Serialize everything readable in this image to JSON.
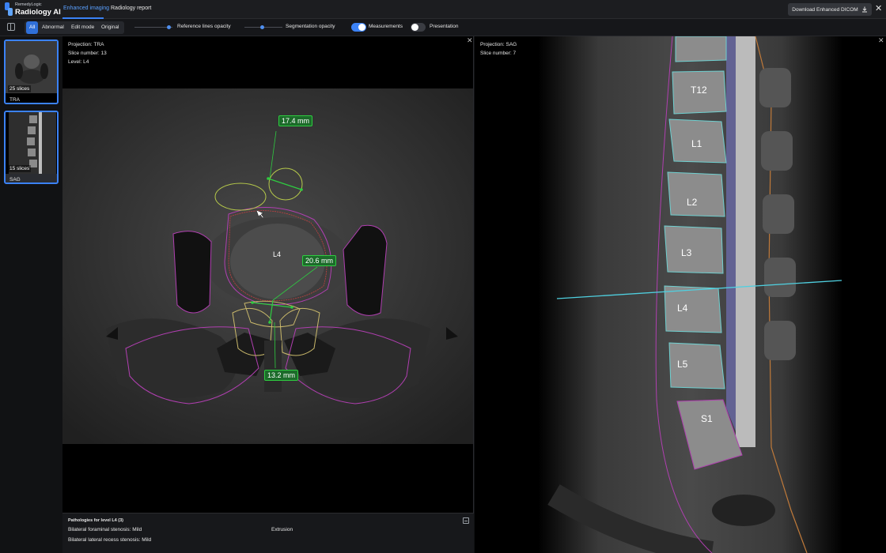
{
  "header": {
    "brand_small": "RemedyLogic",
    "brand": "Radiology AI",
    "tabs": [
      {
        "label": "Enhanced imaging",
        "active": true
      },
      {
        "label": "Radiology report",
        "active": false
      }
    ],
    "download_label": "Download Enhanced DICOM",
    "close_icon": "close-icon"
  },
  "toolbar": {
    "filters": [
      {
        "label": "All",
        "active": true
      },
      {
        "label": "Abnormal",
        "active": false
      },
      {
        "label": "Edit mode",
        "active": false
      },
      {
        "label": "Original",
        "active": false
      }
    ],
    "reference_lines_label": "Reference lines opacity",
    "reference_lines_value": 0.9,
    "segmentation_label": "Segmentation opacity",
    "segmentation_value": 0.45,
    "measurements_label": "Measurements",
    "measurements_on": true,
    "presentation_label": "Presentation",
    "presentation_on": false,
    "accent": "#3b82f6"
  },
  "series": [
    {
      "count": "25 slices",
      "name": "TRA"
    },
    {
      "count": "15 slices",
      "name": "SAG"
    }
  ],
  "viewer_left": {
    "projection": "Projection: TRA",
    "slice": "Slice number: 13",
    "level": "Level: L4",
    "vertebra_label": "L4",
    "measurements": [
      "17.4 mm",
      "20.6 mm",
      "13.2 mm"
    ],
    "measurement_color": "#2ecc40"
  },
  "viewer_right": {
    "projection": "Projection: SAG",
    "slice": "Slice number: 7",
    "vertebrae": [
      "T12",
      "L1",
      "L2",
      "L3",
      "L4",
      "L5",
      "S1"
    ]
  },
  "pathologies": {
    "title": "Pathologies for level L4 (3)",
    "items": [
      "Bilateral foraminal stenosis: Mild",
      "Extrusion",
      "Bilateral lateral recess stenosis: Mild"
    ]
  }
}
